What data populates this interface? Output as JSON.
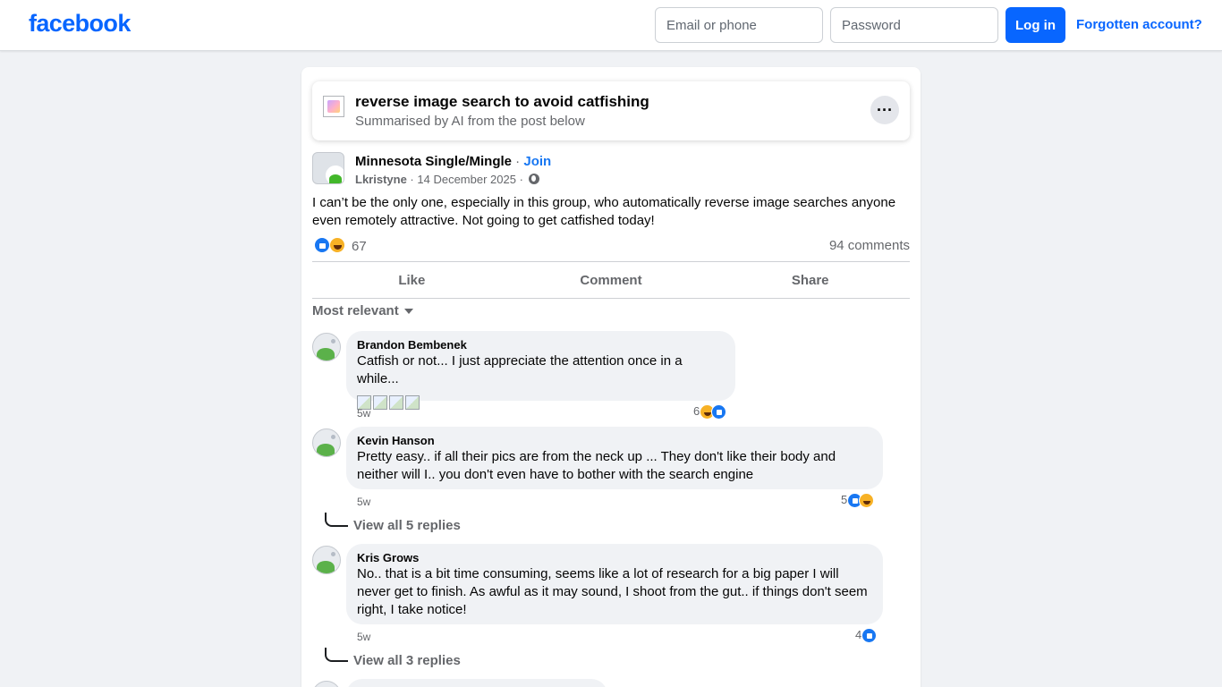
{
  "header": {
    "logo": "facebook",
    "email_placeholder": "Email or phone",
    "password_placeholder": "Password",
    "login_label": "Log in",
    "forgot_label": "Forgotten account?"
  },
  "ai_summary": {
    "title": "reverse image search to avoid catfishing",
    "subtitle": "Summarised by AI from the post below",
    "more_label": "···"
  },
  "post": {
    "group": "Minnesota Single/Mingle",
    "separator": " · ",
    "join_label": "Join",
    "author": "Lkristyne",
    "date": "14 December 2025",
    "text": "I can’t be the only one, especially in this group, who automatically reverse image searches anyone even remotely attractive. Not going to get catfished today!",
    "reaction_count": "67",
    "comments_count": "94 comments",
    "actions": [
      "Like",
      "Comment",
      "Share"
    ]
  },
  "sort_label": "Most relevant",
  "comments": [
    {
      "name": "Brandon Bembenek",
      "text": "Catfish or not... I just appreciate the attention once in a while...",
      "time": "5w",
      "reactions": "6"
    },
    {
      "name": "Kevin Hanson",
      "text": "Pretty easy.. if all their pics are from the neck up ... They don't like their body and neither will I.. you don't even have to bother with the search engine",
      "time": "5w",
      "reactions": "5",
      "replies": "View all 5 replies"
    },
    {
      "name": "Kris Grows",
      "text": "No.. that is a bit time consuming, seems like a lot of research for a big paper I will never get to finish. As awful as it may sound, I shoot from the gut.. if things don't seem right, I take notice!",
      "time": "5w",
      "reactions": "4",
      "replies": "View all 3 replies"
    }
  ]
}
